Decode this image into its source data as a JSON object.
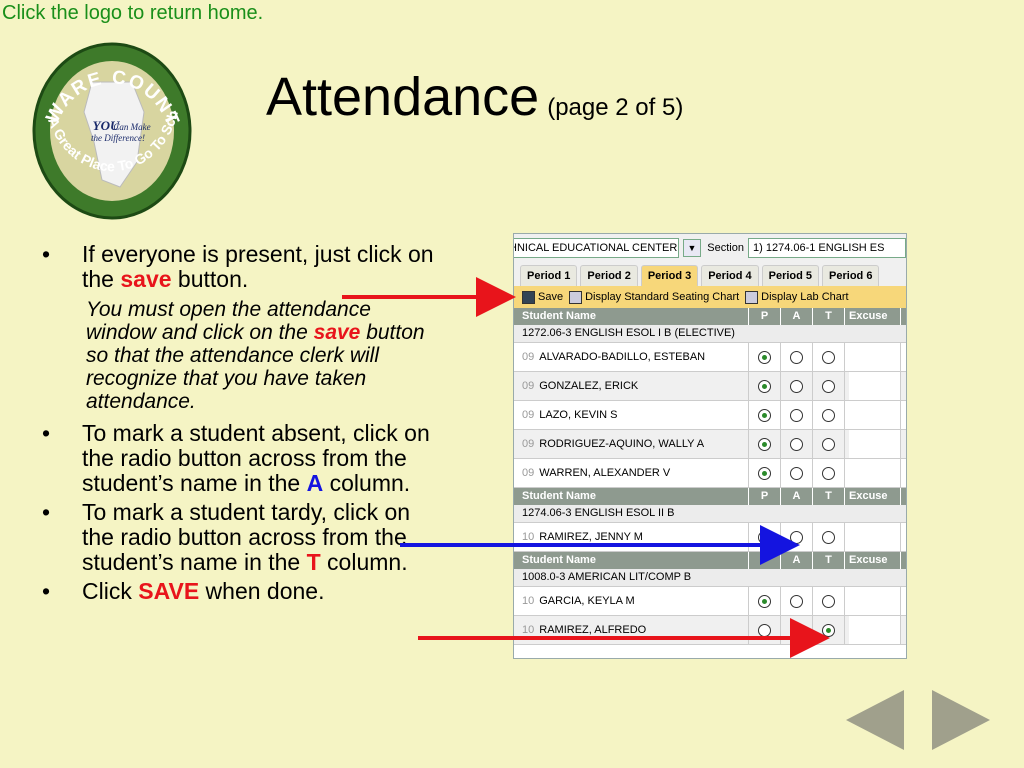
{
  "top_link": "Click the logo to return home.",
  "logo": {
    "text_top": "WARE COUNTY",
    "text_center_1": "YOU",
    "text_center_2": "Can Make",
    "text_center_3": "the Difference!",
    "text_bottom": "A Great Place To Go To School"
  },
  "title": {
    "main": "Attendance",
    "sub": "(page 2 of 5)"
  },
  "bullets": {
    "b1_pre": "If everyone is present, just click on the ",
    "b1_save": "save",
    "b1_post": " button.",
    "note_pre": "You must open the attendance window and click on the ",
    "note_save": "save",
    "note_post": " button so that the attendance clerk will recognize that you have taken attendance.",
    "b2_pre": "To mark a student absent, click on the radio button across from the student’s name in the ",
    "b2_letter": "A",
    "b2_post": " column.",
    "b3_pre": "To mark a student tardy, click on the radio button across from the student’s name in the ",
    "b3_letter": "T",
    "b3_post": " column.",
    "b4_pre": "Click ",
    "b4_save": "SAVE",
    "b4_post": " when done.",
    "bullet_char": "•"
  },
  "screenshot": {
    "school_select": "HNICAL EDUCATIONAL CENTER",
    "dropdown_glyph": "▼",
    "section_label": "Section",
    "section_select": "1) 1274.06-1 ENGLISH ES",
    "tabs": [
      "Period 1",
      "Period 2",
      "Period 3",
      "Period 4",
      "Period 5",
      "Period 6"
    ],
    "toolbar": {
      "save": "Save",
      "seating": "Display Standard Seating Chart",
      "lab": "Display Lab Chart"
    },
    "header": {
      "name": "Student Name",
      "p": "P",
      "a": "A",
      "t": "T",
      "excuse": "Excuse"
    },
    "course1": "1272.06-3 ENGLISH ESOL I B (ELECTIVE)",
    "course2": "1274.06-3 ENGLISH ESOL II B",
    "course3": "1008.0-3 AMERICAN LIT/COMP B",
    "students": [
      {
        "grade": "09",
        "name": "ALVARADO-BADILLO, ESTEBAN"
      },
      {
        "grade": "09",
        "name": "GONZALEZ, ERICK"
      },
      {
        "grade": "09",
        "name": "LAZO, KEVIN S"
      },
      {
        "grade": "09",
        "name": "RODRIGUEZ-AQUINO, WALLY A"
      },
      {
        "grade": "09",
        "name": "WARREN, ALEXANDER V"
      },
      {
        "grade": "10",
        "name": "RAMIREZ, JENNY M"
      },
      {
        "grade": "10",
        "name": "GARCIA, KEYLA M"
      },
      {
        "grade": "10",
        "name": "RAMIREZ, ALFREDO"
      }
    ]
  },
  "colors": {
    "background": "#f5f4c4",
    "accent_red": "#e8141b",
    "accent_blue": "#1414e0",
    "link_green": "#1a8f1a",
    "nav_gray": "#a0a08c"
  },
  "nav": {
    "prev": "previous-slide",
    "next": "next-slide"
  }
}
